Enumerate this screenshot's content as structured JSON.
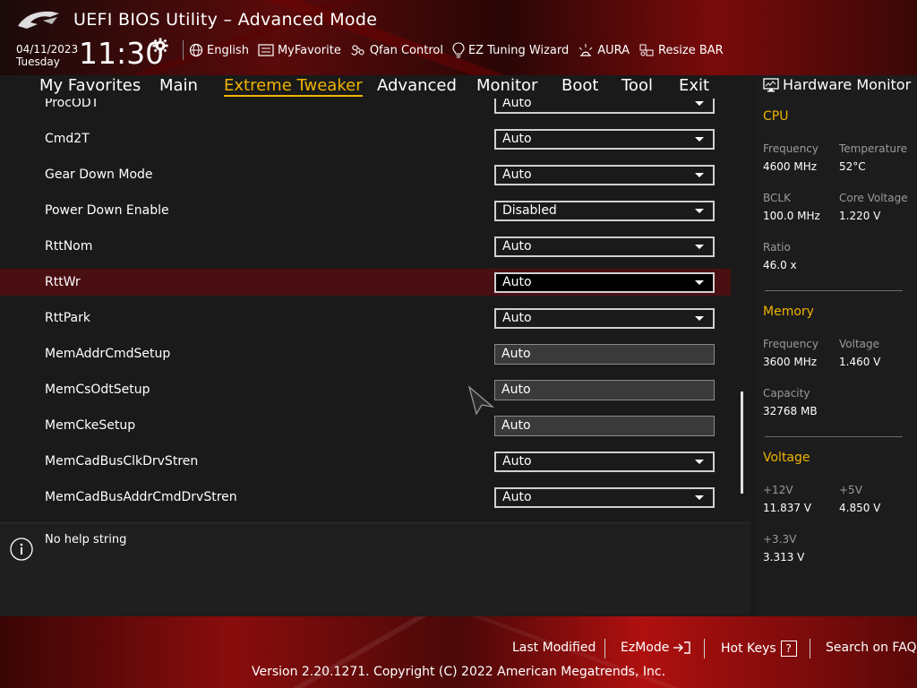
{
  "header": {
    "title": "UEFI BIOS Utility – Advanced Mode",
    "date": "04/11/2023",
    "day": "Tuesday",
    "time": "11:30",
    "toolbar": [
      {
        "label": "English",
        "icon": "globe-icon"
      },
      {
        "label": "MyFavorite",
        "icon": "favorite-list-icon"
      },
      {
        "label": "Qfan Control",
        "icon": "fan-icon"
      },
      {
        "label": "EZ Tuning Wizard",
        "icon": "bulb-icon"
      },
      {
        "label": "AURA",
        "icon": "aura-icon"
      },
      {
        "label": "Resize BAR",
        "icon": "resize-bar-icon"
      }
    ]
  },
  "nav": {
    "tabs": [
      "My Favorites",
      "Main",
      "Extreme Tweaker",
      "Advanced",
      "Monitor",
      "Boot",
      "Tool",
      "Exit"
    ],
    "active": "Extreme Tweaker"
  },
  "settings": [
    {
      "label": "ProcODT",
      "value": "Auto",
      "type": "dropdown"
    },
    {
      "label": "Cmd2T",
      "value": "Auto",
      "type": "dropdown"
    },
    {
      "label": "Gear Down Mode",
      "value": "Auto",
      "type": "dropdown"
    },
    {
      "label": "Power Down Enable",
      "value": "Disabled",
      "type": "dropdown"
    },
    {
      "label": "RttNom",
      "value": "Auto",
      "type": "dropdown"
    },
    {
      "label": "RttWr",
      "value": "Auto",
      "type": "dropdown",
      "selected": true
    },
    {
      "label": "RttPark",
      "value": "Auto",
      "type": "dropdown"
    },
    {
      "label": "MemAddrCmdSetup",
      "value": "Auto",
      "type": "text"
    },
    {
      "label": "MemCsOdtSetup",
      "value": "Auto",
      "type": "text"
    },
    {
      "label": "MemCkeSetup",
      "value": "Auto",
      "type": "text"
    },
    {
      "label": "MemCadBusClkDrvStren",
      "value": "Auto",
      "type": "dropdown"
    },
    {
      "label": "MemCadBusAddrCmdDrvStren",
      "value": "Auto",
      "type": "dropdown"
    }
  ],
  "help": {
    "text": "No help string"
  },
  "hardware_monitor": {
    "title": "Hardware Monitor",
    "cpu": {
      "title": "CPU",
      "frequency_label": "Frequency",
      "frequency": "4600 MHz",
      "temperature_label": "Temperature",
      "temperature": "52°C",
      "bclk_label": "BCLK",
      "bclk": "100.0 MHz",
      "core_voltage_label": "Core Voltage",
      "core_voltage": "1.220 V",
      "ratio_label": "Ratio",
      "ratio": "46.0 x"
    },
    "memory": {
      "title": "Memory",
      "frequency_label": "Frequency",
      "frequency": "3600 MHz",
      "voltage_label": "Voltage",
      "voltage": "1.460 V",
      "capacity_label": "Capacity",
      "capacity": "32768 MB"
    },
    "voltage": {
      "title": "Voltage",
      "v12_label": "+12V",
      "v12": "11.837 V",
      "v5_label": "+5V",
      "v5": "4.850 V",
      "v33_label": "+3.3V",
      "v33": "3.313 V"
    }
  },
  "footer": {
    "last_modified": "Last Modified",
    "ezmode": "EzMode",
    "hot_keys": "Hot Keys",
    "hot_keys_key": "?",
    "search_faq": "Search on FAQ",
    "copyright": "Version 2.20.1271. Copyright (C) 2022 American Megatrends, Inc."
  },
  "colors": {
    "accent": "#f0b400",
    "highlight_row": "#4a0f12",
    "brand_red": "#b01010"
  }
}
